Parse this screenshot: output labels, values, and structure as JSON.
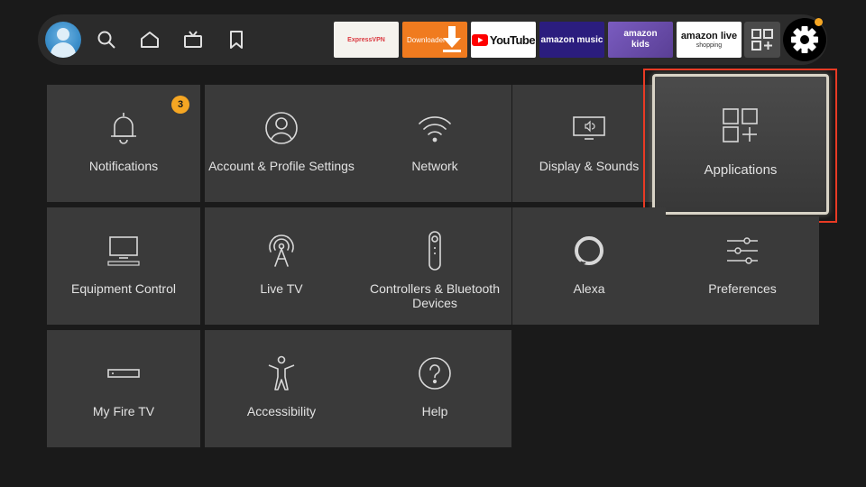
{
  "nav": {
    "icons": [
      "profile-avatar",
      "search-icon",
      "home-icon",
      "live-tv-icon",
      "bookmark-icon"
    ]
  },
  "apps": [
    {
      "name": "ExpressVPN",
      "bg": "#f5f3ee",
      "fg": "#da3940"
    },
    {
      "name": "Downloader",
      "bg": "#f07b1f",
      "fg": "#ffffff"
    },
    {
      "name": "YouTube",
      "bg": "#ffffff",
      "fg": "#111111"
    },
    {
      "name": "amazon music",
      "bg": "#2b1d7e",
      "fg": "#ffffff"
    },
    {
      "name": "amazon kids",
      "bg": "#6b4ea8",
      "fg": "#ffffff"
    },
    {
      "name": "amazon live",
      "sub": "shopping",
      "bg": "#ffffff",
      "fg": "#111111"
    }
  ],
  "settings": {
    "notifications": {
      "label": "Notifications",
      "badge": "3"
    },
    "account": {
      "label": "Account & Profile Settings"
    },
    "network": {
      "label": "Network"
    },
    "display": {
      "label": "Display & Sounds"
    },
    "applications": {
      "label": "Applications"
    },
    "equipment": {
      "label": "Equipment Control"
    },
    "live_tv": {
      "label": "Live TV"
    },
    "controllers": {
      "label": "Controllers & Bluetooth Devices"
    },
    "alexa": {
      "label": "Alexa"
    },
    "preferences": {
      "label": "Preferences"
    },
    "my_fire_tv": {
      "label": "My Fire TV"
    },
    "accessibility": {
      "label": "Accessibility"
    },
    "help": {
      "label": "Help"
    }
  },
  "colors": {
    "accent_badge": "#f5a623",
    "highlight_box": "#e83a24",
    "tile_bg": "#3a3a3a",
    "page_bg": "#1a1a1a"
  }
}
